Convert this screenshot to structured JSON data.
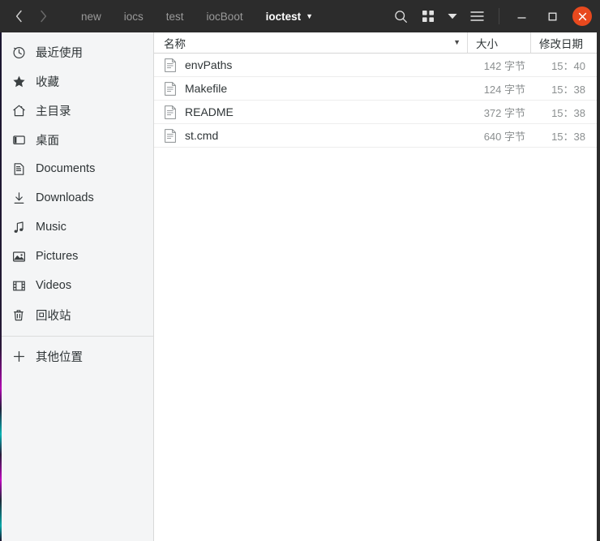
{
  "header": {
    "nav": {
      "back_icon": "chevron-left-icon",
      "forward_icon": "chevron-right-icon",
      "back_label": "‹",
      "forward_label": "›"
    },
    "breadcrumbs": [
      {
        "label": "new",
        "active": false
      },
      {
        "label": "iocs",
        "active": false
      },
      {
        "label": "test",
        "active": false
      },
      {
        "label": "iocBoot",
        "active": false
      },
      {
        "label": "ioctest",
        "active": true
      }
    ],
    "breadcrumb_caret": "▼",
    "tools": [
      {
        "name": "search-icon",
        "label": "search"
      },
      {
        "name": "grid-view-icon",
        "label": "grid view"
      },
      {
        "name": "view-options-chevron-icon",
        "label": "▼"
      },
      {
        "name": "hamburger-menu-icon",
        "label": "menu"
      }
    ],
    "window_controls": {
      "minimize": "–",
      "maximize": "□",
      "close": "✕"
    },
    "close_color": "#e8491e",
    "background": "#2c2c2c"
  },
  "sidebar": {
    "background": "#f4f5f6",
    "items": [
      {
        "label": "最近使用",
        "icon": "clock-icon"
      },
      {
        "label": "收藏",
        "icon": "star-icon"
      },
      {
        "label": "主目录",
        "icon": "home-icon"
      },
      {
        "label": "桌面",
        "icon": "desktop-icon"
      },
      {
        "label": "Documents",
        "icon": "documents-icon"
      },
      {
        "label": "Downloads",
        "icon": "download-icon"
      },
      {
        "label": "Music",
        "icon": "music-note-icon"
      },
      {
        "label": "Pictures",
        "icon": "picture-icon"
      },
      {
        "label": "Videos",
        "icon": "film-icon"
      },
      {
        "label": "回收站",
        "icon": "trash-icon"
      }
    ],
    "other_locations": {
      "label": "其他位置",
      "icon": "plus-icon"
    }
  },
  "file_list": {
    "columns": [
      {
        "label": "名称",
        "key": "name",
        "sorted": true,
        "sort_caret": "▼"
      },
      {
        "label": "大小",
        "key": "size"
      },
      {
        "label": "修改日期",
        "key": "date"
      }
    ],
    "rows": [
      {
        "name": "envPaths",
        "size": "142 字节",
        "date": "15：40",
        "icon": "text-file-icon"
      },
      {
        "name": "Makefile",
        "size": "124 字节",
        "date": "15：38",
        "icon": "text-file-icon"
      },
      {
        "name": "README",
        "size": "372 字节",
        "date": "15：38",
        "icon": "text-file-icon"
      },
      {
        "name": "st.cmd",
        "size": "640 字节",
        "date": "15：38",
        "icon": "text-file-icon"
      }
    ]
  }
}
